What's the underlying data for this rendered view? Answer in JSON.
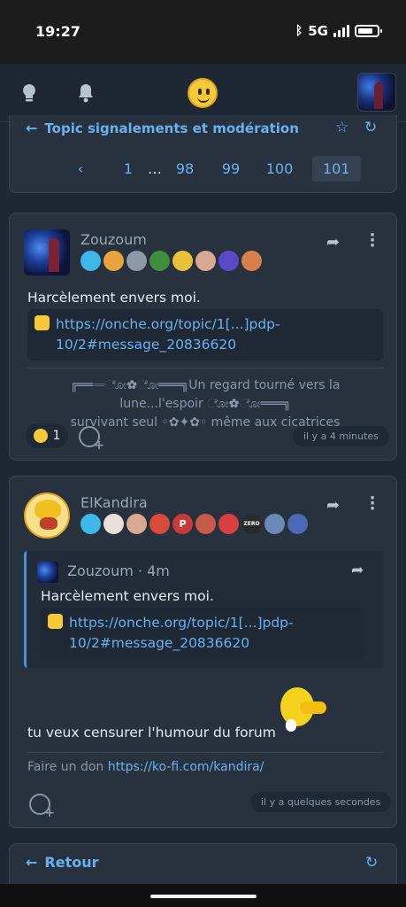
{
  "status_bar": {
    "time": "19:27",
    "network": "5G"
  },
  "topic": {
    "title": "Topic signalements et modération",
    "pages": [
      "1",
      "…",
      "98",
      "99",
      "100",
      "101"
    ],
    "current_page": "101",
    "prev_glyph": "‹"
  },
  "posts": [
    {
      "username": "Zouzoum",
      "badge_colors": [
        "#3db8e8",
        "#e8a43a",
        "#8c99a8",
        "#3f8f3a",
        "#e8c23a",
        "#d8a890",
        "#5a4ac8",
        "#d8804a"
      ],
      "text": "Harcèlement envers moi.",
      "link": "https://onche.org/topic/1[...]pdp-10/2#message_20836620",
      "signature_line1": "╔═══ೋ✿ೋ═══╗Un regard tourné vers la lune...l'espoir ೋ✿ೋ═══╗",
      "signature_line2": "survivant seul ◦✿✦✿◦ même aux cicatrices",
      "reaction_count": "1",
      "time": "il y a 4 minutes"
    },
    {
      "username": "ElKandira",
      "badge_colors": [
        "#3db8e8",
        "#e8e0d8",
        "#d8a890",
        "#d84a3a",
        "#c83a3a",
        "#c85a4a",
        "#d84040",
        "#2a2a2a",
        "#6a8ab8",
        "#4a6ab8"
      ],
      "badge_labels": [
        "",
        "",
        "",
        "",
        "P",
        "",
        "",
        "ZERO",
        "",
        ""
      ],
      "quote": {
        "username": "Zouzoum",
        "time": "· 4m",
        "text": "Harcèlement envers moi.",
        "link": "https://onche.org/topic/1[...]pdp-10/2#message_20836620"
      },
      "text": "tu veux censurer l'humour du forum",
      "donation_label": "Faire un don",
      "donation_link": "https://ko-fi.com/kandira/",
      "time": "il y a quelques secondes"
    }
  ],
  "bottom": {
    "back_label": "Retour"
  },
  "icons": {
    "lightbulb": "lightbulb-icon",
    "bell": "bell-icon",
    "star": "star-icon",
    "refresh": "refresh-icon",
    "share": "share-icon",
    "more": "more-vertical-icon",
    "add_reaction": "add-reaction-icon"
  }
}
